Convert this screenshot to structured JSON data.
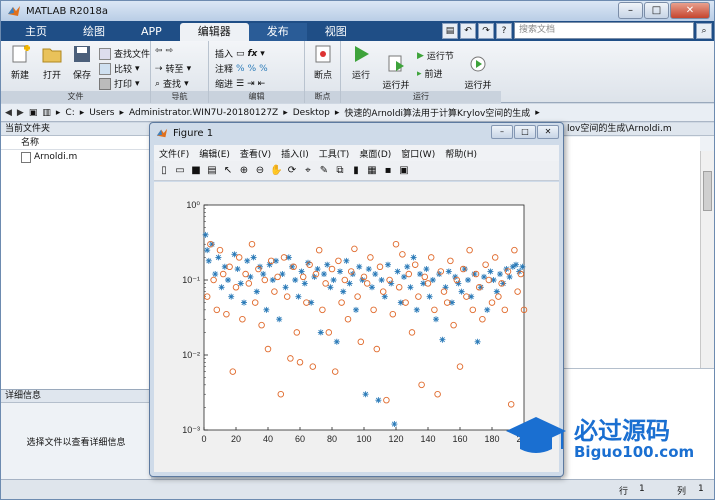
{
  "app": {
    "title": "MATLAB R2018a"
  },
  "window_controls": {
    "minimize": "–",
    "maximize": "□",
    "close": "✕"
  },
  "tabs": [
    {
      "label": "主页"
    },
    {
      "label": "绘图"
    },
    {
      "label": "APP"
    },
    {
      "label": "编辑器"
    },
    {
      "label": "发布"
    },
    {
      "label": "视图"
    }
  ],
  "search": {
    "placeholder": "搜索文档"
  },
  "ribbon": {
    "file": {
      "new": "新建",
      "open": "打开",
      "save": "保存",
      "find_files": "查找文件",
      "compare": "比较",
      "print": "打印",
      "group": "文件"
    },
    "navigate": {
      "goto": "转至",
      "find": "查找",
      "group": "导航"
    },
    "edit": {
      "insert": "插入",
      "comment": "注释",
      "indent": "缩进",
      "fx": "fx",
      "group": "编辑"
    },
    "breakpoints": {
      "label": "断点",
      "group": "断点"
    },
    "run": {
      "run": "运行",
      "run_advance": "运行并\n前进",
      "run_section": "运行节",
      "advance": "前进",
      "run_time": "运行并\n计时",
      "group": "运行"
    }
  },
  "address": {
    "drive": "C:",
    "path": [
      "Users",
      "Administrator.WIN7U-20180127Z",
      "Desktop",
      "快速的Arnoldi算法用于计算Krylov空间的生成"
    ]
  },
  "left_panel": {
    "title": "当前文件夹",
    "col_name": "名称",
    "files": [
      "Arnoldi.m"
    ]
  },
  "details": {
    "title": "详细信息",
    "message": "选择文件以查看详细信息"
  },
  "right_panel": {
    "title": "lov空间的生成\\Arnoldi.m"
  },
  "figure": {
    "title": "Figure 1",
    "menu": [
      "文件(F)",
      "编辑(E)",
      "查看(V)",
      "插入(I)",
      "工具(T)",
      "桌面(D)",
      "窗口(W)",
      "帮助(H)"
    ]
  },
  "status": {
    "row_label": "行",
    "row": "1",
    "col_label": "列",
    "col": "1"
  },
  "watermark": {
    "text1": "必过源码",
    "text2": "Biguo100.com"
  },
  "colors": {
    "blue_series": "#2a7ab8",
    "orange_series": "#e06a2c",
    "tabbar": "#1f4e86"
  },
  "chart_data": {
    "type": "scatter",
    "title": "",
    "xlabel": "",
    "ylabel": "",
    "xlim": [
      0,
      200
    ],
    "ylim": [
      0.001,
      1
    ],
    "yscale": "log",
    "xticks": [
      "0",
      "20",
      "40",
      "60",
      "80",
      "100",
      "120",
      "140",
      "160",
      "180",
      "200"
    ],
    "yticks": [
      "10⁻³",
      "10⁻²",
      "10⁻¹",
      "10⁰"
    ],
    "series": [
      {
        "marker": "star",
        "color": "#2a7ab8",
        "x": [
          1,
          2,
          3,
          5,
          7,
          9,
          11,
          13,
          15,
          17,
          19,
          21,
          23,
          25,
          27,
          29,
          31,
          33,
          35,
          37,
          39,
          41,
          43,
          45,
          47,
          49,
          51,
          53,
          55,
          57,
          59,
          61,
          63,
          65,
          67,
          69,
          71,
          73,
          75,
          77,
          79,
          81,
          83,
          85,
          87,
          89,
          91,
          93,
          95,
          97,
          99,
          101,
          103,
          105,
          107,
          109,
          111,
          113,
          115,
          117,
          119,
          121,
          123,
          125,
          127,
          129,
          131,
          133,
          135,
          137,
          139,
          141,
          143,
          145,
          147,
          149,
          151,
          153,
          155,
          157,
          159,
          161,
          163,
          165,
          167,
          169,
          171,
          173,
          175,
          177,
          179,
          181,
          183,
          185,
          187,
          189,
          191,
          193,
          195,
          197,
          199
        ],
        "y": [
          0.4,
          0.25,
          0.18,
          0.3,
          0.12,
          0.2,
          0.08,
          0.15,
          0.1,
          0.06,
          0.22,
          0.14,
          0.09,
          0.05,
          0.18,
          0.11,
          0.2,
          0.07,
          0.15,
          0.12,
          0.04,
          0.16,
          0.1,
          0.18,
          0.03,
          0.12,
          0.08,
          0.2,
          0.15,
          0.1,
          0.06,
          0.13,
          0.09,
          0.17,
          0.05,
          0.11,
          0.14,
          0.02,
          0.12,
          0.16,
          0.08,
          0.1,
          0.015,
          0.13,
          0.07,
          0.18,
          0.09,
          0.12,
          0.04,
          0.15,
          0.1,
          0.003,
          0.14,
          0.08,
          0.12,
          0.0025,
          0.1,
          0.06,
          0.16,
          0.09,
          0.0012,
          0.13,
          0.05,
          0.11,
          0.15,
          0.08,
          0.2,
          0.04,
          0.12,
          0.09,
          0.14,
          0.06,
          0.1,
          0.03,
          0.12,
          0.016,
          0.08,
          0.13,
          0.05,
          0.11,
          0.09,
          0.07,
          0.14,
          0.1,
          0.06,
          0.12,
          0.015,
          0.08,
          0.11,
          0.04,
          0.13,
          0.1,
          0.07,
          0.12,
          0.09,
          0.14,
          0.11,
          0.15,
          0.16,
          0.13,
          0.15
        ]
      },
      {
        "marker": "circle",
        "color": "#e06a2c",
        "x": [
          2,
          4,
          6,
          8,
          10,
          12,
          14,
          16,
          18,
          20,
          22,
          24,
          26,
          28,
          30,
          32,
          34,
          36,
          38,
          40,
          42,
          44,
          46,
          48,
          50,
          52,
          54,
          56,
          58,
          60,
          62,
          64,
          66,
          68,
          70,
          72,
          74,
          76,
          78,
          80,
          82,
          84,
          86,
          88,
          90,
          92,
          94,
          96,
          98,
          100,
          102,
          104,
          106,
          108,
          110,
          112,
          114,
          116,
          118,
          120,
          122,
          124,
          126,
          128,
          130,
          132,
          134,
          136,
          138,
          140,
          142,
          144,
          146,
          148,
          150,
          152,
          154,
          156,
          158,
          160,
          162,
          164,
          166,
          168,
          170,
          172,
          174,
          176,
          178,
          180,
          182,
          184,
          186,
          188,
          190,
          192,
          194,
          196,
          198,
          200
        ],
        "y": [
          0.06,
          0.3,
          0.1,
          0.04,
          0.25,
          0.12,
          0.035,
          0.15,
          0.006,
          0.08,
          0.2,
          0.03,
          0.12,
          0.09,
          0.3,
          0.05,
          0.14,
          0.025,
          0.1,
          0.012,
          0.18,
          0.07,
          0.11,
          0.003,
          0.2,
          0.06,
          0.009,
          0.15,
          0.02,
          0.008,
          0.11,
          0.05,
          0.16,
          0.007,
          0.12,
          0.25,
          0.04,
          0.09,
          0.02,
          0.14,
          0.006,
          0.18,
          0.05,
          0.1,
          0.03,
          0.13,
          0.26,
          0.06,
          0.015,
          0.11,
          0.09,
          0.2,
          0.04,
          0.012,
          0.15,
          0.07,
          0.0025,
          0.1,
          0.035,
          0.3,
          0.08,
          0.22,
          0.05,
          0.12,
          0.02,
          0.16,
          0.06,
          0.004,
          0.11,
          0.09,
          0.2,
          0.04,
          0.003,
          0.13,
          0.07,
          0.05,
          0.18,
          0.025,
          0.1,
          0.007,
          0.14,
          0.06,
          0.25,
          0.04,
          0.12,
          0.08,
          0.03,
          0.16,
          0.1,
          0.05,
          0.2,
          0.06,
          0.09,
          0.04,
          0.13,
          0.0022,
          0.25,
          0.07,
          0.12,
          0.04
        ]
      }
    ]
  }
}
